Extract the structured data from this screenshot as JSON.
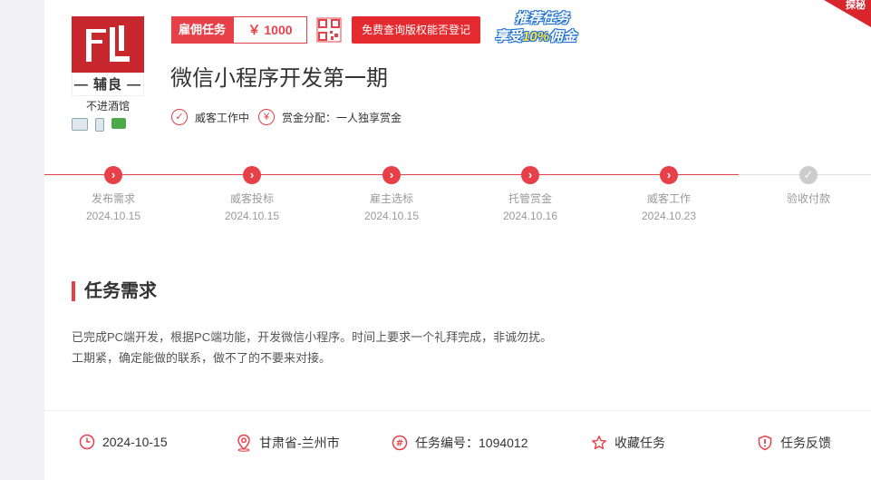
{
  "shop": {
    "logo_text": "— 辅良 —",
    "name": "不进酒馆"
  },
  "task": {
    "tag_label": "雇佣任务",
    "price": "￥ 1000",
    "free_button": "免费查询版权能否登记",
    "promo_line1": "推荐任务",
    "promo_line2_prefix": "享受",
    "promo_line2_highlight": "10%",
    "promo_line2_suffix": "佣金",
    "ribbon_text": "探秘",
    "title": "微信小程序开发第一期",
    "status": "威客工作中",
    "reward_mode": "赏金分配：一人独享赏金"
  },
  "progress": {
    "steps": [
      {
        "label": "发布需求",
        "date": "2024.10.15",
        "done": true
      },
      {
        "label": "威客投标",
        "date": "2024.10.15",
        "done": true
      },
      {
        "label": "雇主选标",
        "date": "2024.10.15",
        "done": true
      },
      {
        "label": "托管赏金",
        "date": "2024.10.16",
        "done": true
      },
      {
        "label": "威客工作",
        "date": "2024.10.23",
        "done": true
      },
      {
        "label": "验收付款",
        "date": "",
        "done": false
      }
    ]
  },
  "requirement": {
    "heading": "任务需求",
    "line1": "已完成PC端开发，根据PC端功能，开发微信小程序。时间上要求一个礼拜完成，非诚勿扰。",
    "line2": "工期紧，确定能做的联系，做不了的不要来对接。"
  },
  "footer": {
    "date": "2024-10-15",
    "location": "甘肃省-兰州市",
    "task_number": "任务编号：1094012",
    "favorite": "收藏任务",
    "feedback": "任务反馈"
  },
  "colors": {
    "accent": "#e84048",
    "gray_step": "#cccccc",
    "promo_blue": "#1d6fd0"
  }
}
